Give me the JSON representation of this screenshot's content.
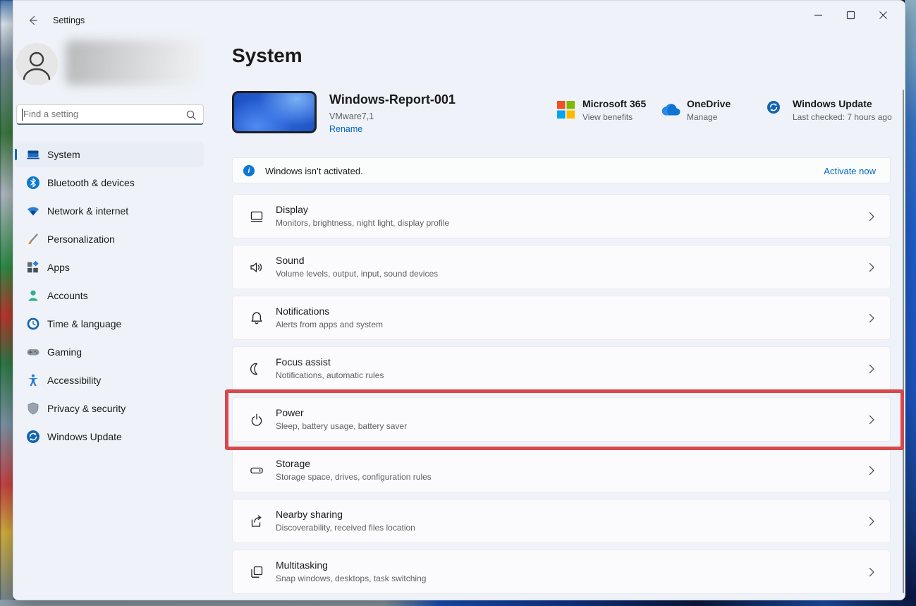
{
  "window": {
    "title": "Settings"
  },
  "sidebar": {
    "search": {
      "placeholder": "Find a setting"
    },
    "items": [
      {
        "label": "System",
        "icon": "system-icon",
        "selected": true
      },
      {
        "label": "Bluetooth & devices",
        "icon": "bluetooth-icon",
        "selected": false
      },
      {
        "label": "Network & internet",
        "icon": "network-icon",
        "selected": false
      },
      {
        "label": "Personalization",
        "icon": "personalization-icon",
        "selected": false
      },
      {
        "label": "Apps",
        "icon": "apps-icon",
        "selected": false
      },
      {
        "label": "Accounts",
        "icon": "accounts-icon",
        "selected": false
      },
      {
        "label": "Time & language",
        "icon": "time-language-icon",
        "selected": false
      },
      {
        "label": "Gaming",
        "icon": "gaming-icon",
        "selected": false
      },
      {
        "label": "Accessibility",
        "icon": "accessibility-icon",
        "selected": false
      },
      {
        "label": "Privacy & security",
        "icon": "privacy-security-icon",
        "selected": false
      },
      {
        "label": "Windows Update",
        "icon": "windows-update-icon",
        "selected": false
      }
    ]
  },
  "page": {
    "title": "System"
  },
  "device": {
    "name": "Windows-Report-001",
    "model": "VMware7,1",
    "rename_label": "Rename"
  },
  "quick_links": [
    {
      "title": "Microsoft 365",
      "subtitle": "View benefits",
      "icon": "microsoft-365-icon"
    },
    {
      "title": "OneDrive",
      "subtitle": "Manage",
      "icon": "onedrive-icon"
    },
    {
      "title": "Windows Update",
      "subtitle": "Last checked: 7 hours ago",
      "icon": "windows-update-icon"
    }
  ],
  "activation_banner": {
    "message": "Windows isn’t activated.",
    "action_label": "Activate now"
  },
  "settings_rows": [
    {
      "title": "Display",
      "subtitle": "Monitors, brightness, night light, display profile",
      "icon": "display-icon",
      "highlighted": false
    },
    {
      "title": "Sound",
      "subtitle": "Volume levels, output, input, sound devices",
      "icon": "sound-icon",
      "highlighted": false
    },
    {
      "title": "Notifications",
      "subtitle": "Alerts from apps and system",
      "icon": "notifications-icon",
      "highlighted": false
    },
    {
      "title": "Focus assist",
      "subtitle": "Notifications, automatic rules",
      "icon": "focus-assist-icon",
      "highlighted": false
    },
    {
      "title": "Power",
      "subtitle": "Sleep, battery usage, battery saver",
      "icon": "power-icon",
      "highlighted": true
    },
    {
      "title": "Storage",
      "subtitle": "Storage space, drives, configuration rules",
      "icon": "storage-icon",
      "highlighted": false
    },
    {
      "title": "Nearby sharing",
      "subtitle": "Discoverability, received files location",
      "icon": "nearby-sharing-icon",
      "highlighted": false
    },
    {
      "title": "Multitasking",
      "subtitle": "Snap windows, desktops, task switching",
      "icon": "multitasking-icon",
      "highlighted": false
    }
  ],
  "colors": {
    "accent": "#0067C0",
    "annotation_red": "#D8474B"
  }
}
